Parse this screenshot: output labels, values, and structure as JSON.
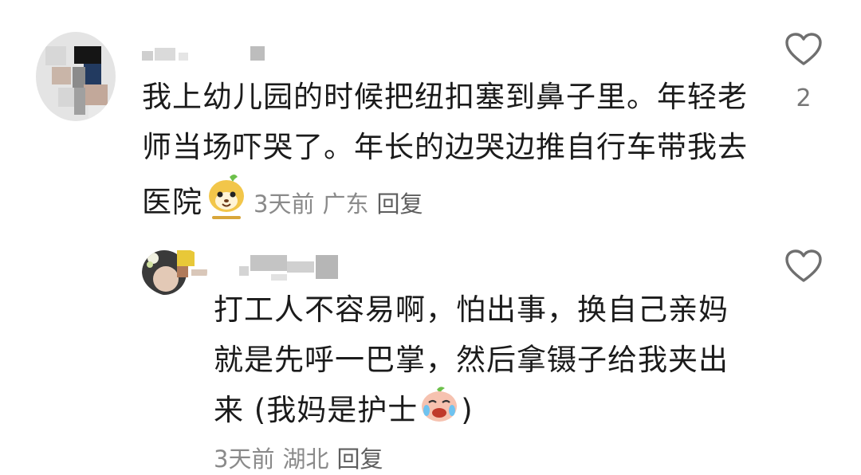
{
  "comments": [
    {
      "text": "我上幼儿园的时候把纽扣塞到鼻子里。年轻老师当场吓哭了。年长的边哭边推自行车带我去医院",
      "emoji": "dog-smile-emoji",
      "time": "3天前",
      "location": "广东",
      "reply_label": "回复",
      "likes": "2",
      "avatar_icon": "blurred-avatar-icon",
      "like_icon": "heart-outline-icon"
    },
    {
      "text": "打工人不容易啊，怕出事，换自己亲妈就是先呼一巴掌，然后拿镊子给我夹出来 (我妈是护士",
      "text_tail": ")",
      "emoji": "crying-laugh-emoji",
      "time": "3天前",
      "location": "湖北",
      "reply_label": "回复",
      "avatar_icon": "blurred-avatar-icon",
      "like_icon": "heart-outline-icon"
    }
  ],
  "colors": {
    "text": "#1b1b1b",
    "meta": "#8a8a8a",
    "icon": "#6f6f6f"
  }
}
